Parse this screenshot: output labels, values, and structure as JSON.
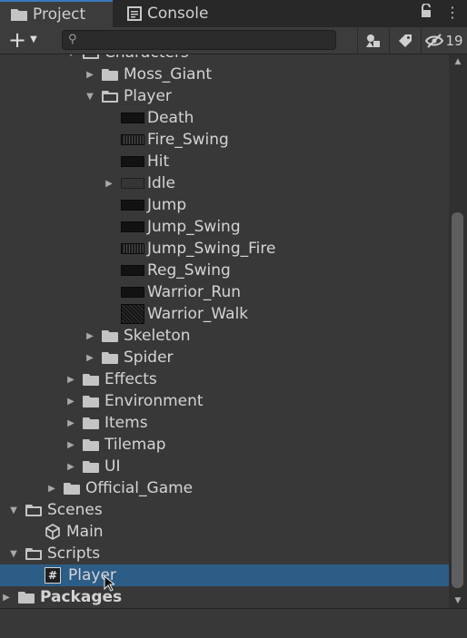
{
  "tabs": [
    {
      "label": "Project",
      "icon": "folder-icon"
    },
    {
      "label": "Console",
      "icon": "console-icon"
    }
  ],
  "search": {
    "placeholder": ""
  },
  "toolbar": {
    "hidden_count": "19"
  },
  "tree": [
    {
      "label": "Characters",
      "depth": 3,
      "type": "folder-open",
      "arrow": "open"
    },
    {
      "label": "Moss_Giant",
      "depth": 4,
      "type": "folder",
      "arrow": "closed"
    },
    {
      "label": "Player",
      "depth": 4,
      "type": "folder-open",
      "arrow": "open"
    },
    {
      "label": "Death",
      "depth": 5,
      "type": "anim",
      "arrow": "none"
    },
    {
      "label": "Fire_Swing",
      "depth": 5,
      "type": "anim-speckle",
      "arrow": "none"
    },
    {
      "label": "Hit",
      "depth": 5,
      "type": "anim",
      "arrow": "none"
    },
    {
      "label": "Idle",
      "depth": 5,
      "type": "anim-faint",
      "arrow": "closed"
    },
    {
      "label": "Jump",
      "depth": 5,
      "type": "anim",
      "arrow": "none"
    },
    {
      "label": "Jump_Swing",
      "depth": 5,
      "type": "anim",
      "arrow": "none"
    },
    {
      "label": "Jump_Swing_Fire",
      "depth": 5,
      "type": "anim-speckle",
      "arrow": "none"
    },
    {
      "label": "Reg_Swing",
      "depth": 5,
      "type": "anim",
      "arrow": "none"
    },
    {
      "label": "Warrior_Run",
      "depth": 5,
      "type": "anim",
      "arrow": "none"
    },
    {
      "label": "Warrior_Walk",
      "depth": 5,
      "type": "anim-square",
      "arrow": "none"
    },
    {
      "label": "Skeleton",
      "depth": 4,
      "type": "folder",
      "arrow": "closed"
    },
    {
      "label": "Spider",
      "depth": 4,
      "type": "folder",
      "arrow": "closed"
    },
    {
      "label": "Effects",
      "depth": 3,
      "type": "folder",
      "arrow": "closed"
    },
    {
      "label": "Environment",
      "depth": 3,
      "type": "folder",
      "arrow": "closed"
    },
    {
      "label": "Items",
      "depth": 3,
      "type": "folder",
      "arrow": "closed"
    },
    {
      "label": "Tilemap",
      "depth": 3,
      "type": "folder",
      "arrow": "closed"
    },
    {
      "label": "UI",
      "depth": 3,
      "type": "folder",
      "arrow": "closed"
    },
    {
      "label": "Official_Game",
      "depth": 2,
      "type": "folder",
      "arrow": "closed"
    },
    {
      "label": "Scenes",
      "depth": 0,
      "type": "folder-open",
      "arrow": "open"
    },
    {
      "label": "Main",
      "depth": 1,
      "type": "scene",
      "arrow": "none"
    },
    {
      "label": "Scripts",
      "depth": 0,
      "type": "folder-open",
      "arrow": "open"
    },
    {
      "label": "Player",
      "depth": 1,
      "type": "script",
      "arrow": "none",
      "selected": true
    },
    {
      "label": "Packages",
      "depth": -1,
      "type": "folder",
      "arrow": "closed",
      "bold": true
    }
  ],
  "colors": {
    "background": "#383838",
    "selection": "#2c5d87",
    "tab_accent": "#3a79bb"
  }
}
